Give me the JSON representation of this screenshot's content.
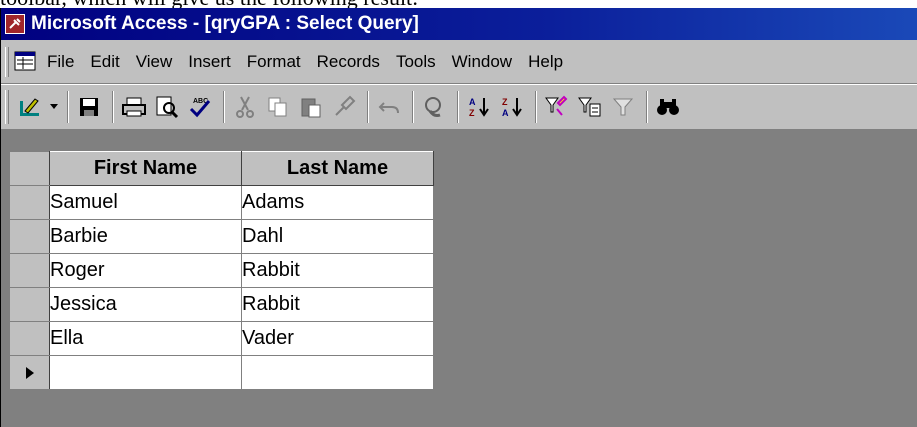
{
  "page_caption": "toolbar, which will give us the following result:",
  "window": {
    "title": "Microsoft Access - [qryGPA : Select Query]"
  },
  "menu": {
    "items": [
      "File",
      "Edit",
      "View",
      "Insert",
      "Format",
      "Records",
      "Tools",
      "Window",
      "Help"
    ]
  },
  "toolbar": {
    "buttons": [
      "design-view-icon",
      "save-icon",
      "print-icon",
      "print-preview-icon",
      "spelling-icon",
      "cut-icon",
      "copy-icon",
      "paste-icon",
      "format-painter-icon",
      "undo-icon",
      "hyperlink-icon",
      "sort-ascending-icon",
      "sort-descending-icon",
      "filter-by-selection-icon",
      "filter-by-form-icon",
      "apply-filter-icon",
      "find-icon"
    ]
  },
  "datasheet": {
    "columns": [
      "First Name",
      "Last Name"
    ],
    "rows": [
      [
        "Samuel",
        "Adams"
      ],
      [
        "Barbie",
        "Dahl"
      ],
      [
        "Roger",
        "Rabbit"
      ],
      [
        "Jessica",
        "Rabbit"
      ],
      [
        "Ella",
        "Vader"
      ]
    ]
  },
  "colors": {
    "titlebar_start": "#000080",
    "titlebar_end": "#1a49b8",
    "chrome": "#c0c0c0",
    "workspace": "#808080"
  }
}
